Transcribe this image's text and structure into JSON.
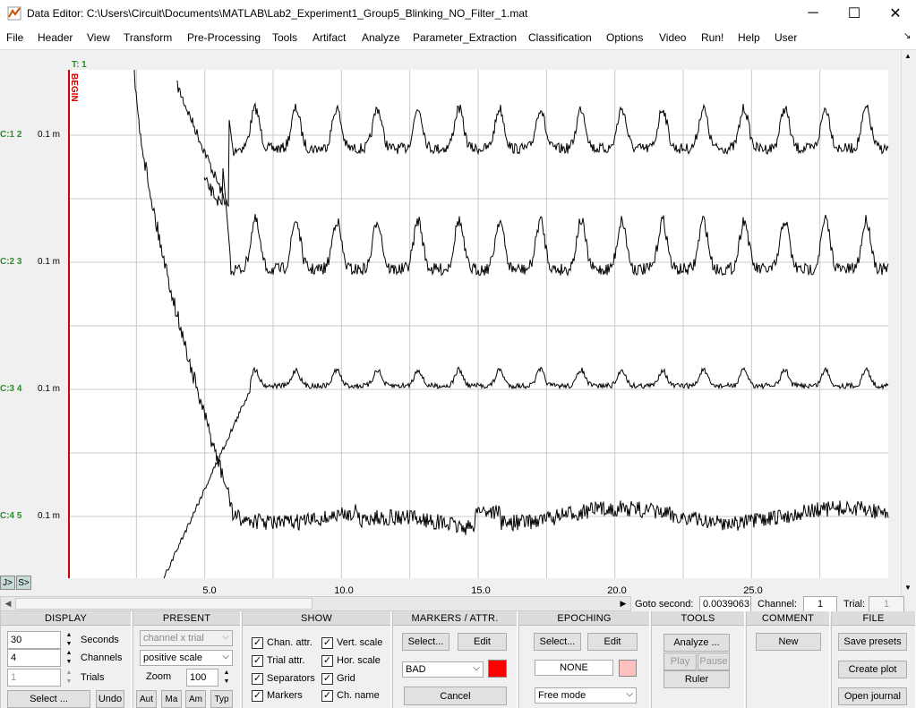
{
  "window": {
    "title": "Data Editor: C:\\Users\\Circuit\\Documents\\MATLAB\\Lab2_Experiment1_Group5_Blinking_NO_Filter_1.mat",
    "minimize_glyph": "─",
    "maximize_glyph": "☐",
    "close_glyph": "✕"
  },
  "menu": [
    "File",
    "Header",
    "View",
    "Transform",
    "Pre-Processing",
    "Tools",
    "Artifact",
    "Analyze",
    "Parameter_Extraction",
    "Classification",
    "Options",
    "Video",
    "Run!",
    "Help",
    "User"
  ],
  "menu_corner_glyph": "↘",
  "plot": {
    "trial_label": "T: 1",
    "begin_label": "BEGIN",
    "channels": [
      {
        "label": "C:1  2",
        "scale": "0.1 m"
      },
      {
        "label": "C:2  3",
        "scale": "0.1 m"
      },
      {
        "label": "C:3  4",
        "scale": "0.1 m"
      },
      {
        "label": "C:4  5",
        "scale": "0.1 m"
      }
    ],
    "xticks": [
      "5.0",
      "10.0",
      "15.0",
      "20.0",
      "25.0"
    ],
    "j_button": "J>",
    "s_button": "S>",
    "trace_color": "#000000",
    "grid_color": "#c8c8c8",
    "begin_color": "#d00000"
  },
  "goto": {
    "goto_label": "Goto second:",
    "goto_value": "0.0039063",
    "channel_label": "Channel:",
    "channel_value": "1",
    "trial_label": "Trial:",
    "trial_value": "1"
  },
  "display": {
    "header": "DISPLAY",
    "seconds_value": "30",
    "seconds_label": "Seconds",
    "channels_value": "4",
    "channels_label": "Channels",
    "trials_value": "1",
    "trials_label": "Trials",
    "select_button": "Select ...",
    "undo_button": "Undo"
  },
  "present": {
    "header": "PRESENT",
    "mode_value": "channel x trial",
    "scale_value": "positive scale",
    "zoom_label": "Zoom",
    "zoom_value": "100",
    "btn_aut": "Aut",
    "btn_ma": "Ma",
    "btn_am": "Am",
    "btn_typ": "Typ"
  },
  "show": {
    "header": "SHOW",
    "items": [
      {
        "label": "Chan. attr.",
        "checked": true
      },
      {
        "label": "Trial attr.",
        "checked": true
      },
      {
        "label": "Separators",
        "checked": true
      },
      {
        "label": "Markers",
        "checked": true
      },
      {
        "label": "Vert. scale",
        "checked": true
      },
      {
        "label": "Hor. scale",
        "checked": true
      },
      {
        "label": "Grid",
        "checked": true
      },
      {
        "label": "Ch. name",
        "checked": true
      }
    ],
    "check_glyph": "✓"
  },
  "markers": {
    "header": "MARKERS / ATTR.",
    "select_button": "Select...",
    "edit_button": "Edit",
    "marker_value": "BAD",
    "marker_color": "#ff0000",
    "cancel_button": "Cancel"
  },
  "epoching": {
    "header": "EPOCHING",
    "select_button": "Select...",
    "edit_button": "Edit",
    "epoch_value": "NONE",
    "epoch_color": "#ffc0c0",
    "mode_value": "Free mode"
  },
  "tools": {
    "header": "TOOLS",
    "analyze_button": "Analyze ...",
    "play_button": "Play",
    "pause_button": "Pause",
    "ruler_button": "Ruler"
  },
  "comment": {
    "header": "COMMENT",
    "new_button": "New"
  },
  "file": {
    "header": "FILE",
    "save_presets_button": "Save presets",
    "create_plot_button": "Create plot",
    "open_journal_button": "Open journal"
  }
}
